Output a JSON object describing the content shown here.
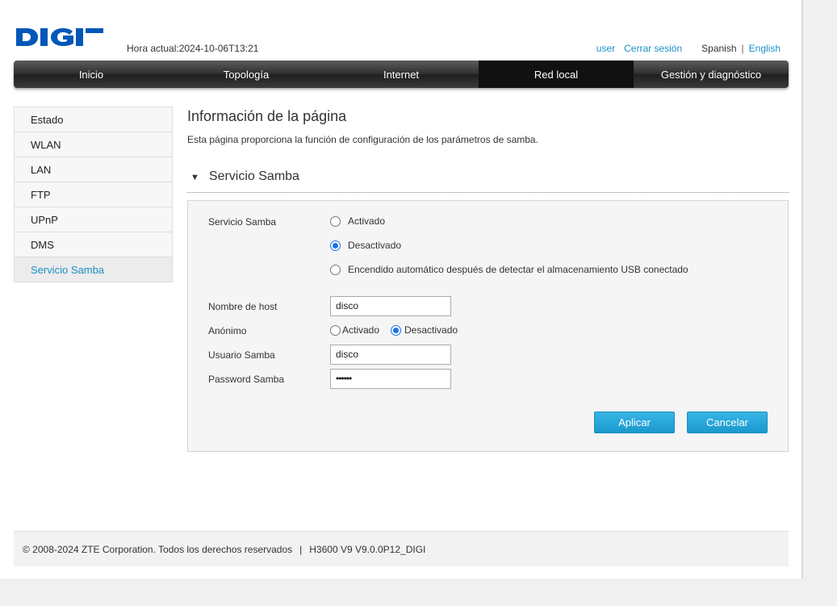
{
  "header": {
    "logo_text": "DIGI",
    "clock": "Hora actual:2024-10-06T13:21",
    "user": "user",
    "logout": "Cerrar sesión",
    "lang_spanish": "Spanish",
    "lang_separator": "|",
    "lang_english": "English",
    "brand_color": "#0057b8",
    "link_color": "#1a8fc6"
  },
  "nav": {
    "tabs": [
      {
        "label": "Inicio"
      },
      {
        "label": "Topología"
      },
      {
        "label": "Internet"
      },
      {
        "label": "Red local",
        "active": true
      },
      {
        "label": "Gestión y diagnóstico"
      }
    ]
  },
  "sidebar": {
    "items": [
      {
        "label": "Estado"
      },
      {
        "label": "WLAN"
      },
      {
        "label": "LAN"
      },
      {
        "label": "FTP"
      },
      {
        "label": "UPnP"
      },
      {
        "label": "DMS"
      },
      {
        "label": "Servicio Samba",
        "active": true
      }
    ]
  },
  "main": {
    "title": "Información de la página",
    "description": "Esta página proporciona la función de configuración de los parámetros de samba.",
    "section_title": "Servicio Samba",
    "section_toggle_icon": "triangle-down-icon",
    "form": {
      "service_label": "Servicio Samba",
      "service_options": [
        {
          "label": "Activado",
          "selected": false
        },
        {
          "label": "Desactivado",
          "selected": true
        },
        {
          "label": "Encendido automático después de detectar el almacenamiento USB conectado",
          "selected": false
        }
      ],
      "hostname_label": "Nombre de host",
      "hostname_value": "disco",
      "anon_label": "Anónimo",
      "anon_options": [
        {
          "label": "Activado",
          "selected": false
        },
        {
          "label": "Desactivado",
          "selected": true
        }
      ],
      "user_label": "Usuario Samba",
      "user_value": "disco",
      "password_label": "Password Samba",
      "password_value": "••••••"
    },
    "apply_label": "Aplicar",
    "cancel_label": "Cancelar"
  },
  "footer": {
    "copyright": "© 2008-2024 ZTE Corporation. Todos los derechos reservados",
    "separator": "|",
    "version": "H3600 V9 V9.0.0P12_DIGI"
  }
}
